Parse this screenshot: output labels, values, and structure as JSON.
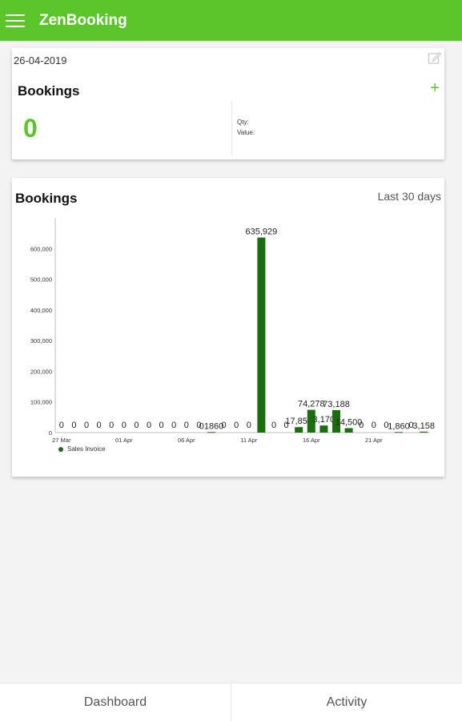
{
  "app": {
    "title": "ZenBooking"
  },
  "summary": {
    "date": "26-04-2019",
    "heading": "Bookings",
    "count": "0",
    "qty_label": "Qty:",
    "value_label": "Value:"
  },
  "chart_card": {
    "heading": "Bookings",
    "range": "Last 30 days",
    "legend": "Sales Invoice"
  },
  "chart_data": {
    "type": "bar",
    "title": "",
    "ylim": [
      0,
      700000
    ],
    "yticks": [
      0,
      100000,
      200000,
      300000,
      400000,
      500000,
      600000
    ],
    "ytick_labels": [
      "0",
      "100,000",
      "200,000",
      "300,000",
      "400,000",
      "500,000",
      "600,000"
    ],
    "xtick_labels": [
      "27 Mar",
      "01 Apr",
      "06 Apr",
      "11 Apr",
      "16 Apr",
      "21 Apr"
    ],
    "series": [
      {
        "name": "Sales Invoice",
        "color": "#1b6e0e",
        "values": [
          0,
          0,
          0,
          0,
          0,
          0,
          0,
          0,
          0,
          0,
          0,
          0,
          1860,
          0,
          0,
          0,
          635929,
          0,
          0,
          17856,
          74278,
          23170,
          73188,
          14500,
          0,
          0,
          0,
          1860,
          0,
          3158
        ],
        "labels": [
          "0",
          "0",
          "0",
          "0",
          "0",
          "0",
          "0",
          "0",
          "0",
          "0",
          "0",
          "0",
          "01860",
          "0",
          "0",
          "0",
          "635,929",
          "0",
          "0",
          "17,856",
          "74,278",
          "3,170",
          "73,188",
          "14,500",
          "0",
          "0",
          "0",
          "1,860",
          "0",
          "3,158"
        ]
      }
    ]
  },
  "nav": {
    "dashboard": "Dashboard",
    "activity": "Activity"
  },
  "colors": {
    "brand": "#5cc52b",
    "bar": "#1b6e0e"
  }
}
